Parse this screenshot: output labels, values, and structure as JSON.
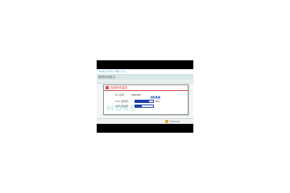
{
  "address_bar": {
    "text": "http://192.168.1.1/"
  },
  "window": {
    "title": "管理系统首页"
  },
  "dialog": {
    "title": "连接状态监控",
    "rows": [
      {
        "label": "PC 名称：",
        "value": "SERVER"
      },
      {
        "label": "CPU 使用率：",
        "percent": 78,
        "percent_text": "78%"
      },
      {
        "label": "内存 使用率：",
        "percent": 35,
        "percent_text": ""
      }
    ],
    "link": "刷新数据"
  },
  "watermark": "MORE",
  "status": {
    "text": "Internet"
  },
  "colors": {
    "accent": "#39a6b5",
    "bar": "#1a3ea7",
    "alert": "#e44c4c"
  }
}
